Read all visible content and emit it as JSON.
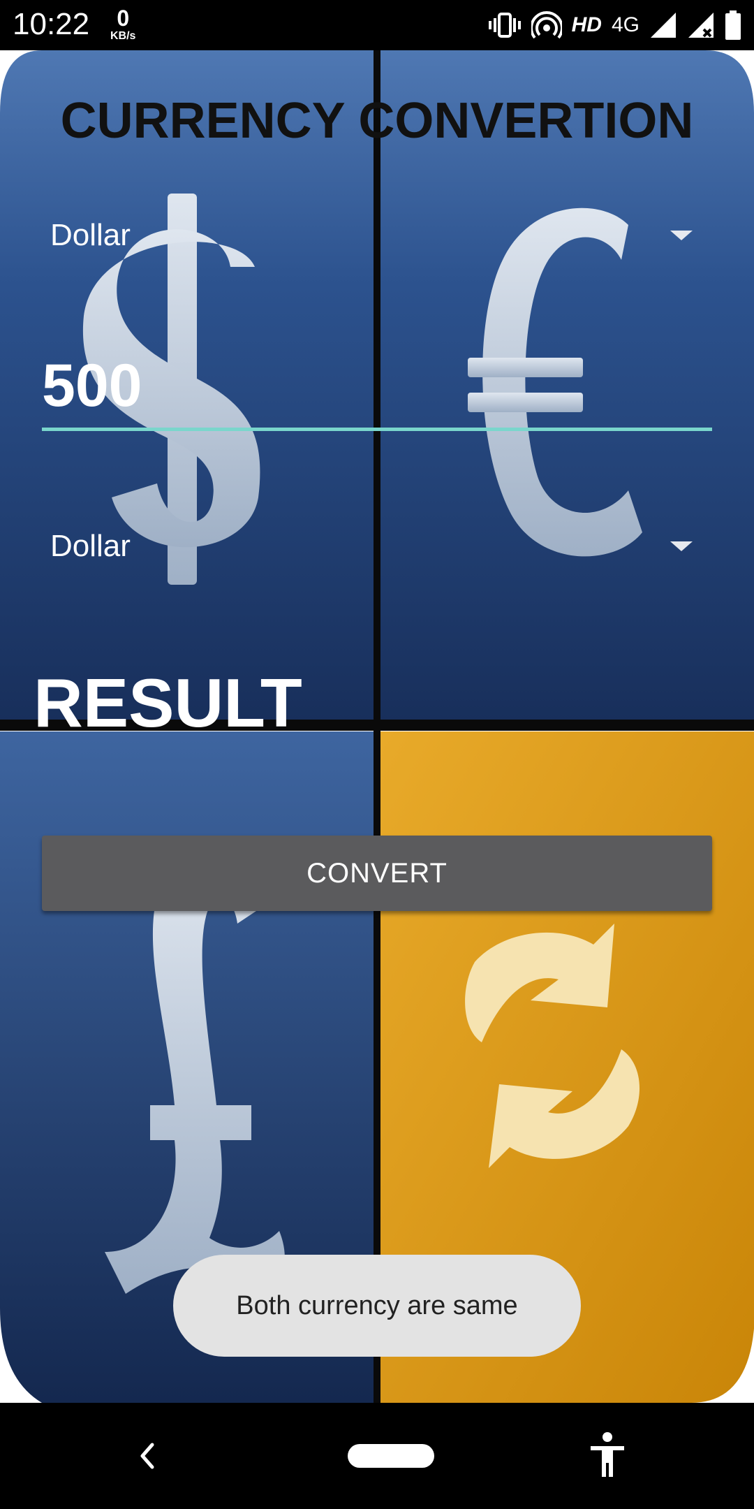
{
  "status_bar": {
    "time": "10:22",
    "net_speed_value": "0",
    "net_speed_unit": "KB/s",
    "hd_label": "HD",
    "network_label": "4G"
  },
  "app": {
    "title": "CURRENCY CONVERTION",
    "from_currency": "Dollar",
    "amount_value": "500",
    "to_currency": "Dollar",
    "result_label": "RESULT",
    "convert_button_label": "CONVERT",
    "toast_message": "Both currency are same"
  },
  "colors": {
    "accent_underline": "#7ad6cc",
    "button_bg": "#5b5b5d",
    "panel_blue": "#1e3a6a",
    "panel_gold": "#d99a18"
  },
  "icons": {
    "status": [
      "vibrate-icon",
      "hotspot-icon",
      "signal-icon",
      "signal-no-data-icon",
      "battery-icon"
    ],
    "nav": [
      "back-icon",
      "home-pill-icon",
      "accessibility-icon"
    ]
  }
}
